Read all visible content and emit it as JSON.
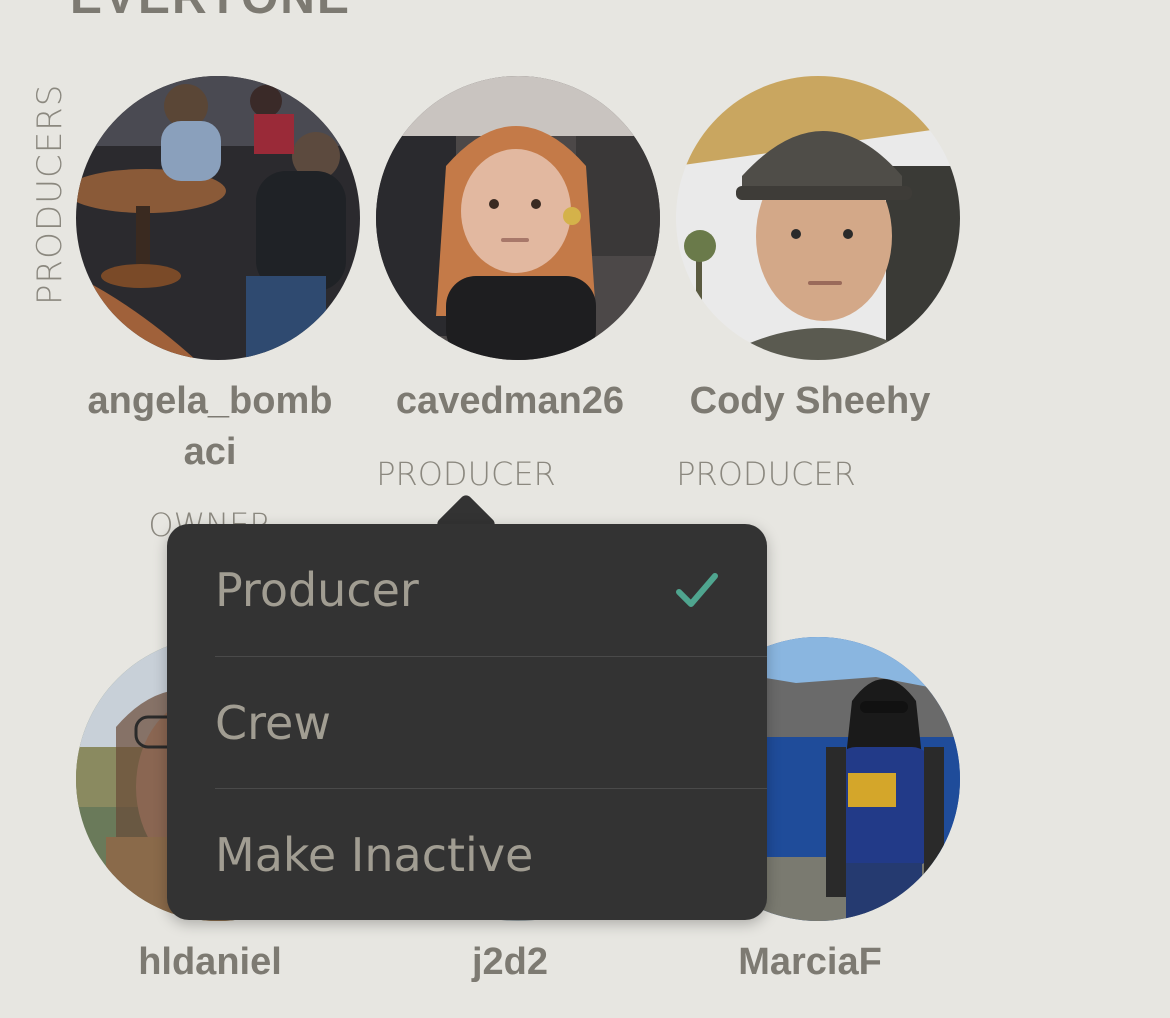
{
  "header": {
    "title": "EVERYONE"
  },
  "section": {
    "label": "PRODUCERS"
  },
  "members": [
    {
      "name_line1": "angela_bomb",
      "name_line2": "aci",
      "role": "OWNER"
    },
    {
      "name": "cavedman26",
      "role": "PRODUCER"
    },
    {
      "name": "Cody Sheehy",
      "role": "PRODUCER"
    },
    {
      "name": "hldaniel"
    },
    {
      "name": "j2d2"
    },
    {
      "name": "MarciaF"
    }
  ],
  "role_menu": {
    "items": [
      {
        "label": "Producer",
        "selected": true
      },
      {
        "label": "Crew",
        "selected": false
      },
      {
        "label": "Make Inactive",
        "selected": false
      }
    ],
    "check_icon": "checkmark-icon",
    "check_color": "#4fa58f"
  },
  "colors": {
    "background": "#e7e6e1",
    "text": "#7d7a72",
    "popup": "#333333"
  }
}
